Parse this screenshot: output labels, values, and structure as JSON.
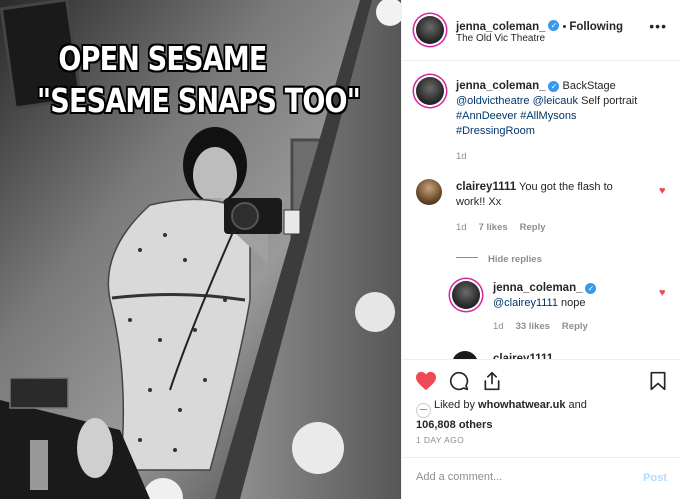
{
  "photo": {
    "meme_line1": "OPEN SESAME",
    "meme_line2": "\"SESAME SNAPS TOO\""
  },
  "header": {
    "username": "jenna_coleman_",
    "separator": "•",
    "follow_status": "Following",
    "location": "The Old Vic Theatre",
    "more_icon": "ellipsis-icon"
  },
  "caption": {
    "username": "jenna_coleman_",
    "text": "BackStage",
    "mentions": "@oldvictheatre @leicauk",
    "text2": "Self portrait",
    "hashtags1": "#AnnDeever #AllMysons",
    "hashtags2": "#DressingRoom",
    "time": "1d"
  },
  "comment1": {
    "username": "clairey1111",
    "text": "You got the flash to",
    "text2": "work!! Xx",
    "time": "1d",
    "likes": "7 likes",
    "reply": "Reply"
  },
  "hide_replies": "Hide replies",
  "reply1": {
    "username": "jenna_coleman_",
    "mention": "@clairey1111",
    "text": "nope",
    "time": "1d",
    "likes": "33 likes",
    "reply": "Reply"
  },
  "partial_comment": {
    "username": "clairey1111"
  },
  "likes": {
    "prefix": "Liked by",
    "user": "whowhatwear.uk",
    "and": "and",
    "count": "106,808 others"
  },
  "date": "1 DAY AGO",
  "add_comment": {
    "placeholder": "Add a comment...",
    "post_label": "Post"
  },
  "colors": {
    "heart": "#ed4956",
    "link": "#00376b",
    "verified": "#3897f0",
    "post_disabled": "#b3dbff"
  }
}
